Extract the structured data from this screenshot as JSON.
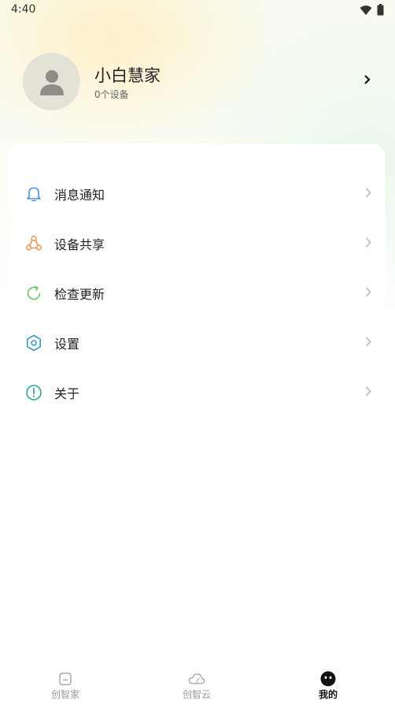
{
  "status_bar": {
    "time": "4:40"
  },
  "profile": {
    "name": "小白慧家",
    "subtitle": "0个设备"
  },
  "menu": {
    "items": [
      {
        "label": "消息通知",
        "icon": "bell-icon",
        "color": "#4a90d9"
      },
      {
        "label": "设备共享",
        "icon": "share-icon",
        "color": "#e8965a"
      },
      {
        "label": "检查更新",
        "icon": "refresh-icon",
        "color": "#6cc46e"
      },
      {
        "label": "设置",
        "icon": "gear-icon",
        "color": "#3a9ac9"
      },
      {
        "label": "关于",
        "icon": "info-icon",
        "color": "#2aa79a"
      }
    ]
  },
  "tabbar": {
    "tabs": [
      {
        "label": "创智家",
        "icon": "home-icon",
        "active": false
      },
      {
        "label": "创智云",
        "icon": "cloud-icon",
        "active": false
      },
      {
        "label": "我的",
        "icon": "mine-icon",
        "active": true
      }
    ]
  }
}
